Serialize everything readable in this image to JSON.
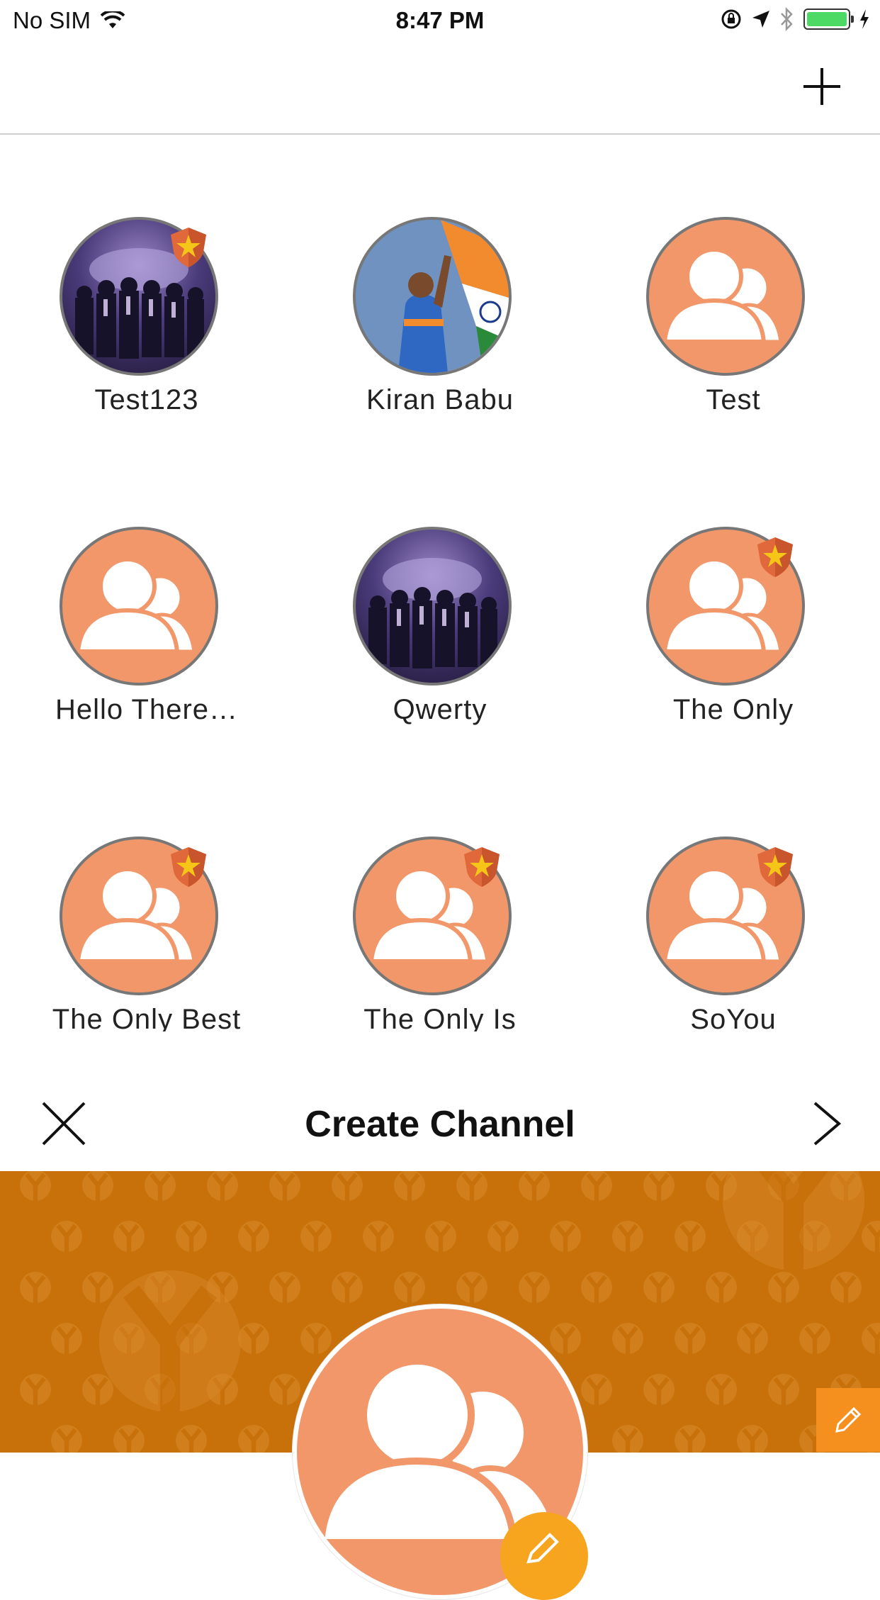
{
  "status_bar": {
    "carrier": "No SIM",
    "time": "8:47 PM",
    "battery_percent": 100
  },
  "nav": {
    "add_icon": "plus-icon"
  },
  "channels": [
    {
      "name": "Test123",
      "avatar": "photo-crowd",
      "featured": true
    },
    {
      "name": "Kiran Babu",
      "avatar": "photo-cricket",
      "featured": false
    },
    {
      "name": "Test",
      "avatar": "default-group",
      "featured": false
    },
    {
      "name": "Hello There…",
      "avatar": "default-group",
      "featured": false
    },
    {
      "name": "Qwerty",
      "avatar": "photo-crowd",
      "featured": false
    },
    {
      "name": "The Only",
      "avatar": "default-group",
      "featured": true
    },
    {
      "name": "The Only Best",
      "avatar": "default-group",
      "featured": true
    },
    {
      "name": "The Only Is",
      "avatar": "default-group",
      "featured": true
    },
    {
      "name": "SoYou",
      "avatar": "default-group",
      "featured": true
    }
  ],
  "create_channel": {
    "title": "Create Channel",
    "close_icon": "close-icon",
    "next_icon": "chevron-right-icon"
  },
  "colors": {
    "avatar_orange": "#f2976a",
    "banner_orange": "#c8700a",
    "edit_orange": "#f5901e",
    "badge_red": "#e0683a",
    "badge_star": "#f5c518"
  }
}
